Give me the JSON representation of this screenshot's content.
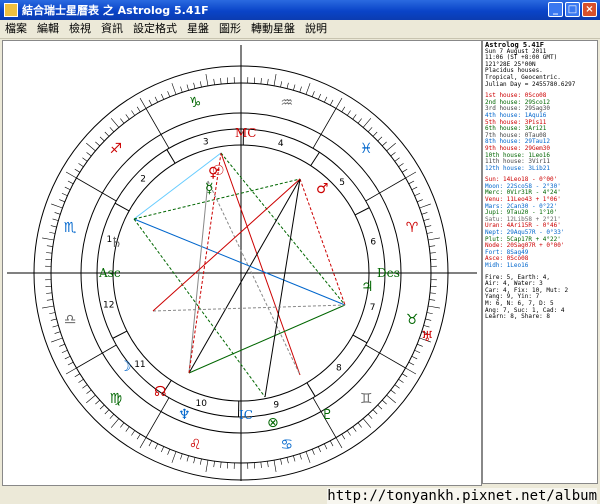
{
  "window": {
    "title": "結合瑞士星曆表 之 Astrolog 5.41F",
    "minimize": "_",
    "maximize": "□",
    "close": "×"
  },
  "menu": [
    "檔案",
    "編輯",
    "檢視",
    "資訊",
    "設定格式",
    "星盤",
    "圖形",
    "轉動星盤",
    "說明"
  ],
  "chart": {
    "axis_labels": {
      "asc": "Asc",
      "des": "Des",
      "mc": "MC",
      "ic": "IC"
    },
    "house_numbers": [
      "1",
      "2",
      "3",
      "4",
      "5",
      "6",
      "7",
      "8",
      "9",
      "10",
      "11",
      "12"
    ]
  },
  "info": {
    "header": [
      "Astrolog 5.41F",
      "Sun 7 August 2011",
      "11:06 (ST +8:00 GMT)",
      "121°28E 25°00N",
      "Placidus houses.",
      "Tropical, Geocentric.",
      "Julian Day = 2455780.6297"
    ],
    "houses": [
      "1st house:  0Sco08",
      "2nd house: 29Sco12",
      "3rd house: 29Sag30",
      "4th house:  1Aqu16",
      "5th house:  3Pis11",
      "6th house:  3Ari21",
      "7th house:  0Tau08",
      "8th house: 29Tau12",
      "9th house: 29Gem30",
      "10th house:  1Leo16",
      "11th house:  3Vir11",
      "12th house:  3Lib21"
    ],
    "planets": [
      "Sun: 14Leo18  - 0°00'",
      "Moon: 22Sco58 - 2°30'",
      "Merc:  0Vir31R - 4°24'",
      "Venu: 11Leo43  + 1°06'",
      "Mars:  2Can30  - 0°22'",
      "Jupi:  9Tau20  - 1°10'",
      "Satu: 12Lib58  + 2°21'",
      "Uran:  4Ari15R - 0°46'",
      "Nept: 29Aqu57R - 0°33'",
      "Plut:  5Cap17R + 4°22'",
      "Node: 20Sag07R + 0°00'",
      "Fort:  8Sag49",
      "Asce:  0Sco08",
      "Midh:  1Leo16"
    ],
    "summary": [
      "Fire: 5, Earth: 4,",
      "Air: 4, Water: 3",
      "Car: 4, Fix: 10, Mut: 2",
      "Yang: 9, Yin: 7",
      "M: 6, N: 6, 7, D: 5",
      "Ang: 7, Suc: 1, Cad: 4",
      "Learn: 8, Share: 8"
    ]
  },
  "watermark": "http://tonyankh.pixnet.net/album"
}
